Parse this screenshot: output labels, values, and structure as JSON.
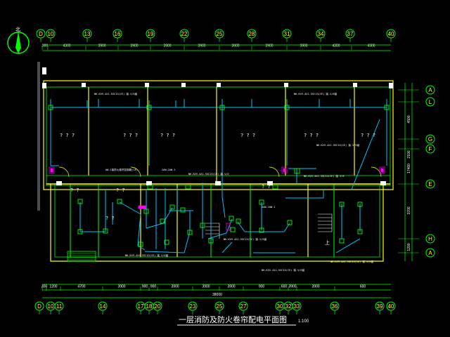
{
  "drawing": {
    "title": "一层消防及防火卷帘配电平面图",
    "scale": "1:100",
    "north_label": "北",
    "overall_dimension": "38000",
    "colors": {
      "background": "#000000",
      "axis_bubble": "#00ff00",
      "axis_label": "#ffff00",
      "wall": "#ffff00",
      "wall_inner": "#00ff00",
      "wiring": "#00bfff",
      "text": "#ffffff",
      "equipment": "#ff00ff"
    }
  },
  "grid_top": {
    "axes": [
      "D",
      "10",
      "13",
      "16",
      "19",
      "22",
      "25",
      "28",
      "31",
      "34",
      "37",
      "40"
    ],
    "dimensions": [
      "300",
      "4300",
      "3900",
      "3900",
      "3900",
      "3900",
      "3600",
      "3900",
      "3900",
      "4300",
      "4300"
    ]
  },
  "grid_bottom": {
    "axes": [
      "D",
      "10",
      "11",
      "14",
      "17",
      "18",
      "20",
      "23",
      "25",
      "27",
      "30",
      "32",
      "33",
      "36",
      "39",
      "40"
    ],
    "dimensions": [
      "300",
      "1200",
      "4700",
      "3900",
      "900",
      "900",
      "3900",
      "3900",
      "3900",
      "900",
      "600",
      "3900",
      "3900",
      "600"
    ]
  },
  "grid_right": {
    "axes": [
      "A",
      "L",
      "G",
      "F",
      "E",
      "H",
      "A"
    ],
    "dimensions": [
      "4500",
      "2100",
      "17400",
      "3700",
      "1200"
    ]
  },
  "room_marks": [
    "? ? ?",
    "? ? ?",
    "? ? ?",
    "? ? ?",
    "? ? ?",
    "? ? ?",
    "? ?",
    "? ?",
    "? ?",
    "? ?",
    "上"
  ],
  "cable_notes": [
    "NH-KVV-4X1.5SC15(CE) 接-V/E级",
    "NH-KVV-4X1.5SC15(CE) 接-V/E级",
    "NH-KVV-4X1.5SC15(CE) 接-V/E级",
    "AW-1接防火卷帘控制箱(CE)",
    "2AW-2AW-1",
    "NH-KVV-4X1.5SC15(CE) 接-V/E",
    "NH-KVV-4X1.5SC15(CE) 接-V/E",
    "NH-KVV-4X1.5SC15(CE) 接-V/E级",
    "NH-KVV-4X1.5SC15(CE) 接-V/E级",
    "NH-KVV-4X1.5SC15(CE) 接-V/E级",
    "2AW-2AW-1",
    "NH-KVV-4X1.5SC15(CE) 接-V/E级"
  ]
}
